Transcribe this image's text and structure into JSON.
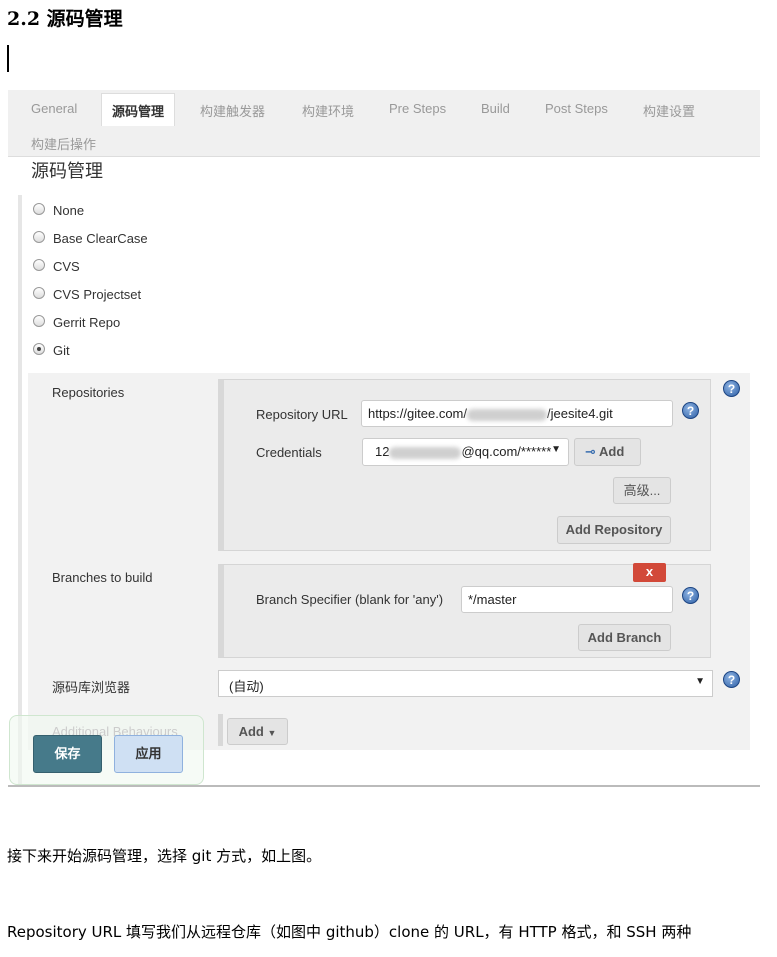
{
  "doc": {
    "heading": "2.2 源码管理",
    "paragraphs": [
      "接下来开始源码管理，选择 git 方式，如上图。",
      "Repository URL 填写我们从远程仓库（如图中 github）clone 的 URL，有 HTTP 格式，和 SSH 两种"
    ]
  },
  "tabs": [
    "General",
    "源码管理",
    "构建触发器",
    "构建环境",
    "Pre Steps",
    "Build",
    "Post Steps",
    "构建设置",
    "构建后操作"
  ],
  "section_title": "源码管理",
  "scm_options": [
    {
      "label": "None",
      "selected": false
    },
    {
      "label": "Base ClearCase",
      "selected": false
    },
    {
      "label": "CVS",
      "selected": false
    },
    {
      "label": "CVS Projectset",
      "selected": false
    },
    {
      "label": "Gerrit Repo",
      "selected": false
    },
    {
      "label": "Git",
      "selected": true
    }
  ],
  "git": {
    "repositories_label": "Repositories",
    "repo_url_label": "Repository URL",
    "repo_url_prefix": "https://gitee.com/",
    "repo_url_suffix": "/jeesite4.git",
    "credentials_label": "Credentials",
    "credentials_prefix": "12",
    "credentials_suffix": "@qq.com/******",
    "add_label": "Add",
    "advanced_label": "高级...",
    "add_repository_label": "Add Repository",
    "branches_label": "Branches to build",
    "delete_label": "x",
    "branch_spec_label": "Branch Specifier (blank for 'any')",
    "branch_spec_value": "*/master",
    "add_branch_label": "Add Branch",
    "browser_label": "源码库浏览器",
    "browser_value": "(自动)",
    "additional_label": "Additional Behaviours",
    "additional_add_label": "Add"
  },
  "footer": {
    "save_label": "保存",
    "apply_label": "应用"
  },
  "colors": {
    "save": "#467a8a",
    "apply": "#cfe0f3",
    "delete": "#d24939"
  }
}
